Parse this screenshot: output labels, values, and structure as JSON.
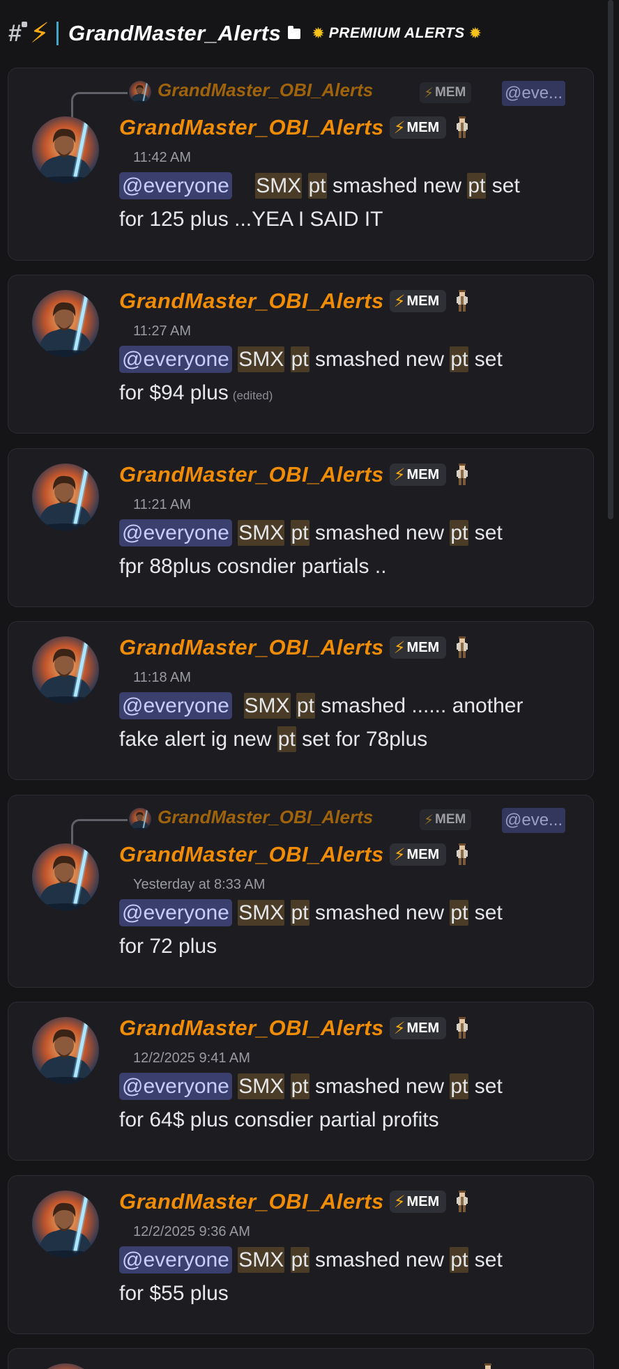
{
  "header": {
    "channel_name": "GrandMaster_Alerts",
    "category_label": "PREMIUM ALERTS"
  },
  "icons": {
    "channel": "hash-lock-icon",
    "bolt": "lightning-bolt-icon",
    "folder": "folder-icon",
    "sun": "sun-icon",
    "jedi": "jedi-role-icon"
  },
  "colors": {
    "username": "#f08c06",
    "mention_bg": "#3b3f6e",
    "highlight_bg": "#4a3c27",
    "card_bg": "#1c1c21"
  },
  "tag_label": "MEM",
  "mention_label": "@everyone",
  "reply_mention_label": "@eve...",
  "messages": [
    {
      "username": "GrandMaster_OBI_Alerts",
      "reply_to": "GrandMaster_OBI_Alerts",
      "timestamp": "11:42 AM",
      "line1_a": "SMX",
      "line1_b": "pt",
      "line1_c": "smashed new",
      "line1_d": "pt",
      "line1_e": "set",
      "line2": "for 125 plus ...YEA I SAID IT"
    },
    {
      "username": "GrandMaster_OBI_Alerts",
      "timestamp": "11:27 AM",
      "line1_a": "SMX",
      "line1_b": "pt",
      "line1_c": "smashed new",
      "line1_d": "pt",
      "line1_e": "set",
      "line2": "for $94 plus",
      "edited": "(edited)"
    },
    {
      "username": "GrandMaster_OBI_Alerts",
      "timestamp": "11:21 AM",
      "line1_a": "SMX",
      "line1_b": "pt",
      "line1_c": "smashed new",
      "line1_d": "pt",
      "line1_e": "set",
      "line2": "fpr 88plus cosndier partials .."
    },
    {
      "username": "GrandMaster_OBI_Alerts",
      "timestamp": "11:18 AM",
      "line1_a": "SMX",
      "line1_b": "pt",
      "line1_c": "smashed ...... another",
      "line2_a": "fake alert ig new",
      "line2_b": "pt",
      "line2_c": "set for 78plus"
    },
    {
      "username": "GrandMaster_OBI_Alerts",
      "reply_to": "GrandMaster_OBI_Alerts",
      "timestamp": "Yesterday at 8:33 AM",
      "line1_a": "SMX",
      "line1_b": "pt",
      "line1_c": "smashed new",
      "line1_d": "pt",
      "line1_e": "set",
      "line2": "for 72 plus"
    },
    {
      "username": "GrandMaster_OBI_Alerts",
      "timestamp": "12/2/2025 9:41 AM",
      "line1_a": "SMX",
      "line1_b": "pt",
      "line1_c": "smashed new",
      "line1_d": "pt",
      "line1_e": "set",
      "line2": "for 64$ plus consdier partial profits"
    },
    {
      "username": "GrandMaster_OBI_Alerts",
      "timestamp": "12/2/2025 9:36 AM",
      "line1_a": "SMX",
      "line1_b": "pt",
      "line1_c": "smashed new",
      "line1_d": "pt",
      "line1_e": "set",
      "line2": "for $55 plus"
    }
  ]
}
